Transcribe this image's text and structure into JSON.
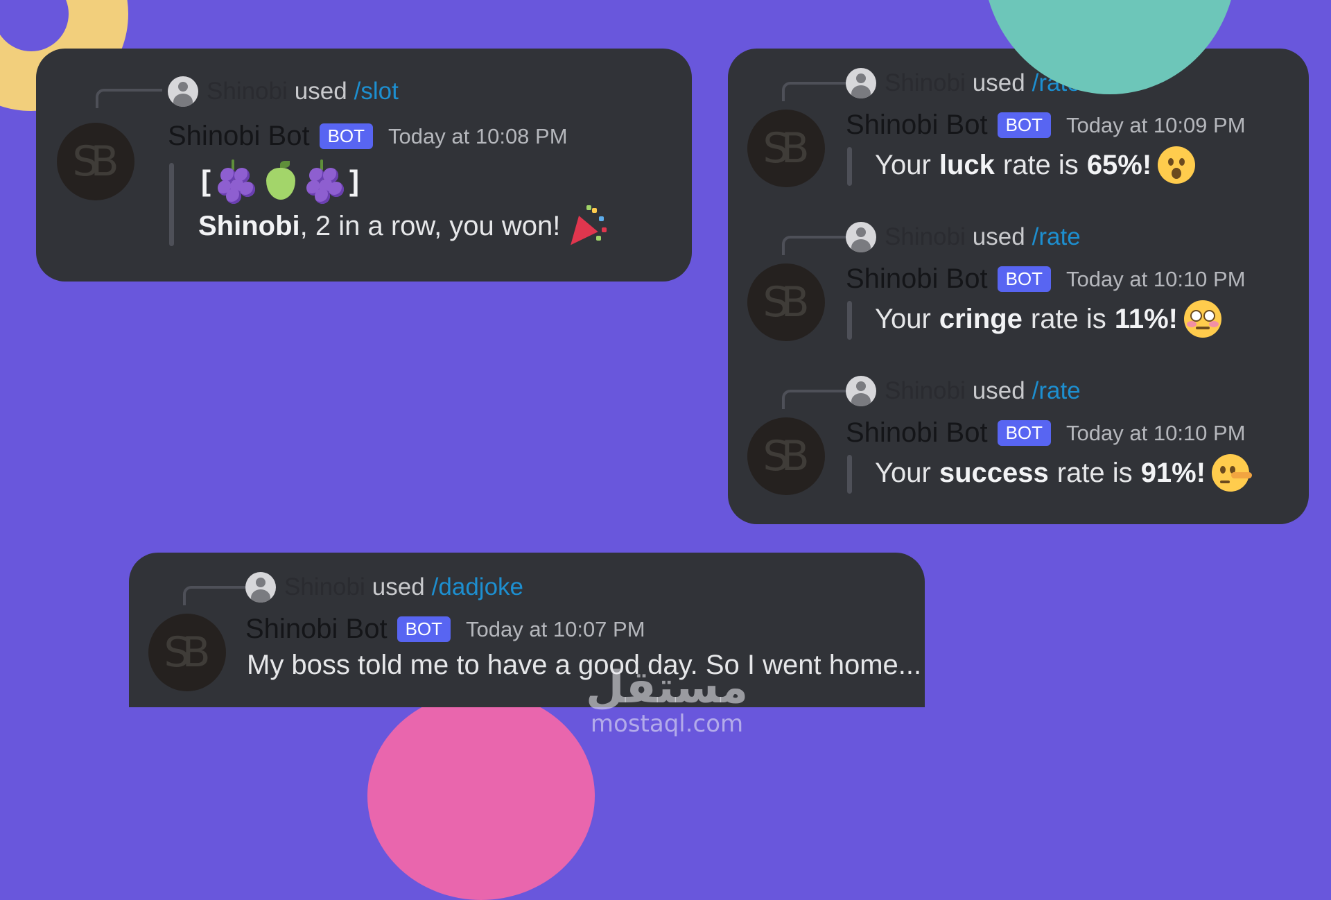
{
  "colors": {
    "background": "#6957dc",
    "card": "#313338",
    "badge": "#5865f2",
    "command_link": "#1d8fd0",
    "deco_yellow": "#f2cf7c",
    "deco_teal": "#6dc6b9",
    "deco_pink": "#e966ad"
  },
  "avatar_initials": "SB",
  "slot": {
    "reply_user": "Shinobi",
    "reply_used": "used",
    "reply_command": "/slot",
    "bot_name": "Shinobi Bot",
    "badge": "BOT",
    "timestamp": "Today at 10:08 PM",
    "slot_open": "[",
    "slot_close": "]",
    "slot_emojis": [
      "grapes",
      "pear",
      "grapes"
    ],
    "winner": "Shinobi",
    "result_text": ", 2 in a row, you won!",
    "result_emoji": "party-popper"
  },
  "rates": [
    {
      "reply_user": "Shinobi",
      "reply_used": "used",
      "reply_command": "/rate",
      "bot_name": "Shinobi Bot",
      "badge": "BOT",
      "timestamp": "Today at 10:09 PM",
      "prefix": "Your",
      "category": "luck",
      "middle": "rate is",
      "value": "65%!",
      "emoji": "hushed-face"
    },
    {
      "reply_user": "Shinobi",
      "reply_used": "used",
      "reply_command": "/rate",
      "bot_name": "Shinobi Bot",
      "badge": "BOT",
      "timestamp": "Today at 10:10 PM",
      "prefix": "Your",
      "category": "cringe",
      "middle": "rate is",
      "value": "11%!",
      "emoji": "flushed-face"
    },
    {
      "reply_user": "Shinobi",
      "reply_used": "used",
      "reply_command": "/rate",
      "bot_name": "Shinobi Bot",
      "badge": "BOT",
      "timestamp": "Today at 10:10 PM",
      "prefix": "Your",
      "category": "success",
      "middle": "rate is",
      "value": "91%!",
      "emoji": "lying-face"
    }
  ],
  "dadjoke": {
    "reply_user": "Shinobi",
    "reply_used": "used",
    "reply_command": "/dadjoke",
    "bot_name": "Shinobi Bot",
    "badge": "BOT",
    "timestamp": "Today at 10:07 PM",
    "text": "My boss told me to have a good day. So I went home..."
  },
  "watermark": {
    "arabic": "مستقل",
    "latin": "mostaql.com"
  }
}
